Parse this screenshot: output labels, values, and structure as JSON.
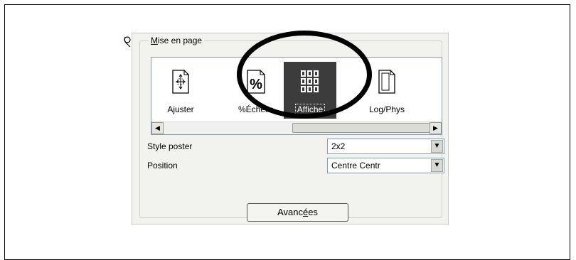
{
  "groupbox": {
    "title_accel": "M",
    "title_rest": "ise en page"
  },
  "layout_modes": [
    {
      "label": "Ajuster",
      "icon": "fit-page-icon",
      "selected": false
    },
    {
      "label": "%Échelle",
      "icon": "percent-scale-icon",
      "selected": false
    },
    {
      "label": "Affiche",
      "icon": "poster-grid-icon",
      "selected": true
    },
    {
      "label": "Log/Phys",
      "icon": "logical-physical-icon",
      "selected": false
    }
  ],
  "labels_visible": {
    "ajuster": "Ajuster",
    "echelle": "%Échelle",
    "affiche": "Affiche",
    "logphys": "Log/Phys"
  },
  "poster_style": {
    "label": "Style poster",
    "value": "2x2"
  },
  "position": {
    "label": "Position",
    "value": "Centre Centr"
  },
  "advanced_button": {
    "pre": "Avanc",
    "accel": "é",
    "post": "es"
  },
  "colors": {
    "selected_bg": "#3c3c3c",
    "panel_bg": "#f2f2ef",
    "callout": "#000000"
  }
}
